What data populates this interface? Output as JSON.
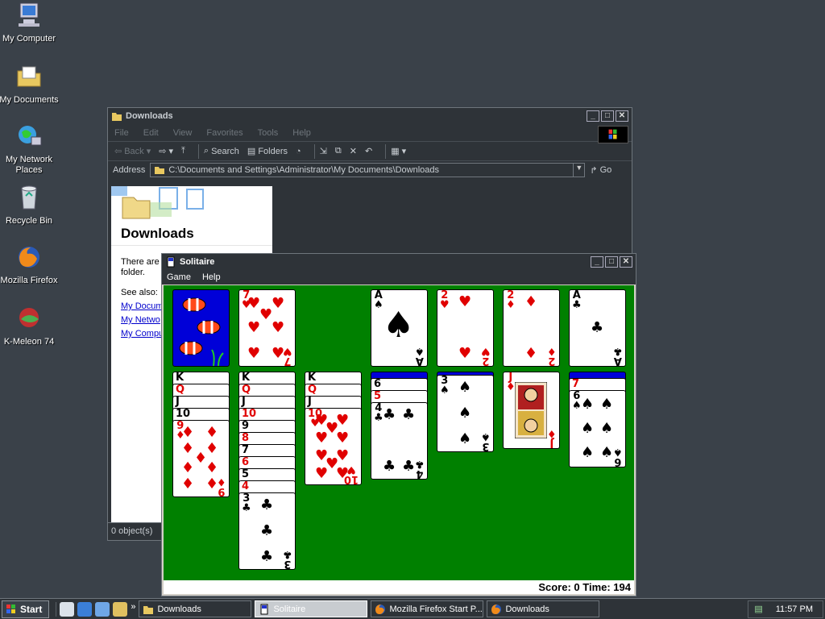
{
  "desktop": {
    "icons": [
      {
        "label": "My Computer",
        "icon": "computer-icon"
      },
      {
        "label": "My Documents",
        "icon": "documents-folder-icon"
      },
      {
        "label": "My Network Places",
        "icon": "network-icon"
      },
      {
        "label": "Recycle Bin",
        "icon": "recycle-bin-icon"
      },
      {
        "label": "Mozilla Firefox",
        "icon": "firefox-icon"
      },
      {
        "label": "K-Meleon 74",
        "icon": "kmeleon-icon"
      }
    ]
  },
  "explorer": {
    "title": "Downloads",
    "menu": [
      "File",
      "Edit",
      "View",
      "Favorites",
      "Tools",
      "Help"
    ],
    "toolbar": {
      "back": "Back",
      "search": "Search",
      "folders": "Folders"
    },
    "address_label": "Address",
    "address_value": "C:\\Documents and Settings\\Administrator\\My Documents\\Downloads",
    "go_label": "Go",
    "panel_title": "Downloads",
    "panel_text": "There are",
    "panel_text2": "folder.",
    "see_also": "See also:",
    "links": [
      "My Docum",
      "My Netwo",
      "My Compu"
    ],
    "status": "0 object(s)"
  },
  "solitaire": {
    "title": "Solitaire",
    "menu": [
      "Game",
      "Help"
    ],
    "status": "Score: 0 Time: 194",
    "colors": {
      "felt": "#008000",
      "card_back": "#0000d8",
      "red": "#e00000"
    }
  },
  "taskbar": {
    "start_label": "Start",
    "tasks": [
      {
        "label": "Downloads",
        "icon": "folder-icon"
      },
      {
        "label": "Solitaire",
        "icon": "solitaire-icon"
      },
      {
        "label": "Mozilla Firefox Start P...",
        "icon": "firefox-icon"
      },
      {
        "label": "Downloads",
        "icon": "firefox-icon"
      }
    ],
    "clock": "11:57 PM"
  }
}
